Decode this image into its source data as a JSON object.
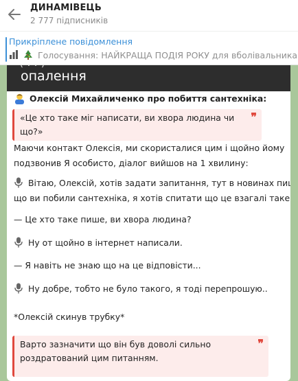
{
  "header": {
    "title": "ДИНАМІВЕЦЬ",
    "subscribers": "2 777 підписників"
  },
  "pinned": {
    "label": "Прикріплене повідомлення",
    "text": "Голосування: НАЙКРАЩА ПОДІЯ РОКУ для вболівальника Ди"
  },
  "message": {
    "media_caption": "опалення",
    "heading": "Олексій Михайличенко про побиття сантехніка:",
    "quote1": "«Це хто таке міг написати, ви хвора людина чи що?»",
    "intro": [
      "Маючи контакт Олексія, ми скористалися цим і щойно йому",
      "подзвонив Я особисто, діалог вийшов на 1 хвилину:"
    ],
    "q1": [
      "Вітаю, Олексій, хотів задати запитання, тут в новинах пишуть",
      "що ви побили сантехніка, я хотів спитати що це взагалі таке."
    ],
    "a1": "— Це хто таке пише, ви хвора людина?",
    "q2": "Ну от щойно в інтернет написали.",
    "a2": "— Я навіть не знаю що на це відповісти...",
    "q3": "Ну добре, тобто не було такого, я тоді перепрошую..",
    "hangup": "*Олексій скинув трубку*",
    "quote2": "Варто зазначити що він був доволі сильно роздратований цим питанням."
  },
  "colors": {
    "accent": "#3a8fd8",
    "quote_border": "#e0483d",
    "quote_bg": "#fdeceb",
    "chat_bg": "#a9c79b"
  },
  "icons": {
    "back": "arrow-left-icon",
    "pinned_emojis": [
      "bar-chart-icon",
      "christmas-tree-icon"
    ],
    "heading_emoji": "person-icon",
    "speaker_emoji": "microphone-icon",
    "quote_mark": "quote-mark-icon"
  }
}
